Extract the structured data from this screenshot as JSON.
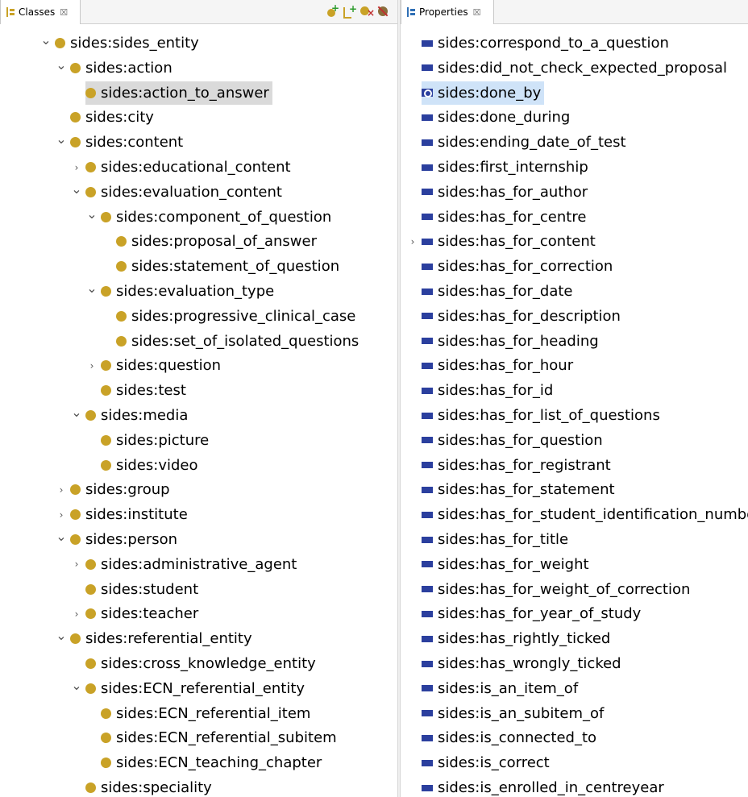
{
  "classes_panel": {
    "tab_label": "Classes",
    "tab_close": "☒",
    "toolbar": {
      "add_subclass": "add-subclass-icon",
      "add_sibling": "add-sibling-icon",
      "delete_class": "delete-class-icon",
      "deprecate": "deprecate-icon"
    },
    "items": [
      {
        "label": "sides:sides_entity",
        "depth": 0,
        "expander": "open"
      },
      {
        "label": "sides:action",
        "depth": 1,
        "expander": "open"
      },
      {
        "label": "sides:action_to_answer",
        "depth": 2,
        "expander": "none",
        "selected": true
      },
      {
        "label": "sides:city",
        "depth": 1,
        "expander": "none"
      },
      {
        "label": "sides:content",
        "depth": 1,
        "expander": "open"
      },
      {
        "label": "sides:educational_content",
        "depth": 2,
        "expander": "closed"
      },
      {
        "label": "sides:evaluation_content",
        "depth": 2,
        "expander": "open"
      },
      {
        "label": "sides:component_of_question",
        "depth": 3,
        "expander": "open"
      },
      {
        "label": "sides:proposal_of_answer",
        "depth": 4,
        "expander": "none"
      },
      {
        "label": "sides:statement_of_question",
        "depth": 4,
        "expander": "none"
      },
      {
        "label": "sides:evaluation_type",
        "depth": 3,
        "expander": "open"
      },
      {
        "label": "sides:progressive_clinical_case",
        "depth": 4,
        "expander": "none"
      },
      {
        "label": "sides:set_of_isolated_questions",
        "depth": 4,
        "expander": "none"
      },
      {
        "label": "sides:question",
        "depth": 3,
        "expander": "closed"
      },
      {
        "label": "sides:test",
        "depth": 3,
        "expander": "none"
      },
      {
        "label": "sides:media",
        "depth": 2,
        "expander": "open"
      },
      {
        "label": "sides:picture",
        "depth": 3,
        "expander": "none"
      },
      {
        "label": "sides:video",
        "depth": 3,
        "expander": "none"
      },
      {
        "label": "sides:group",
        "depth": 1,
        "expander": "closed"
      },
      {
        "label": "sides:institute",
        "depth": 1,
        "expander": "closed"
      },
      {
        "label": "sides:person",
        "depth": 1,
        "expander": "open"
      },
      {
        "label": "sides:administrative_agent",
        "depth": 2,
        "expander": "closed"
      },
      {
        "label": "sides:student",
        "depth": 2,
        "expander": "none"
      },
      {
        "label": "sides:teacher",
        "depth": 2,
        "expander": "closed"
      },
      {
        "label": "sides:referential_entity",
        "depth": 1,
        "expander": "open"
      },
      {
        "label": "sides:cross_knowledge_entity",
        "depth": 2,
        "expander": "none"
      },
      {
        "label": "sides:ECN_referential_entity",
        "depth": 2,
        "expander": "open"
      },
      {
        "label": "sides:ECN_referential_item",
        "depth": 3,
        "expander": "none"
      },
      {
        "label": "sides:ECN_referential_subitem",
        "depth": 3,
        "expander": "none"
      },
      {
        "label": "sides:ECN_teaching_chapter",
        "depth": 3,
        "expander": "none"
      },
      {
        "label": "sides:speciality",
        "depth": 2,
        "expander": "none"
      }
    ]
  },
  "properties_panel": {
    "tab_label": "Properties",
    "tab_close": "☒",
    "items": [
      {
        "label": "sides:correspond_to_a_question",
        "expander": "none"
      },
      {
        "label": "sides:did_not_check_expected_proposal",
        "expander": "none"
      },
      {
        "label": "sides:done_by",
        "expander": "none",
        "selected": true
      },
      {
        "label": "sides:done_during",
        "expander": "none"
      },
      {
        "label": "sides:ending_date_of_test",
        "expander": "none"
      },
      {
        "label": "sides:first_internship",
        "expander": "none"
      },
      {
        "label": "sides:has_for_author",
        "expander": "none"
      },
      {
        "label": "sides:has_for_centre",
        "expander": "none"
      },
      {
        "label": "sides:has_for_content",
        "expander": "closed"
      },
      {
        "label": "sides:has_for_correction",
        "expander": "none"
      },
      {
        "label": "sides:has_for_date",
        "expander": "none"
      },
      {
        "label": "sides:has_for_description",
        "expander": "none"
      },
      {
        "label": "sides:has_for_heading",
        "expander": "none"
      },
      {
        "label": "sides:has_for_hour",
        "expander": "none"
      },
      {
        "label": "sides:has_for_id",
        "expander": "none"
      },
      {
        "label": "sides:has_for_list_of_questions",
        "expander": "none"
      },
      {
        "label": "sides:has_for_question",
        "expander": "none"
      },
      {
        "label": "sides:has_for_registrant",
        "expander": "none"
      },
      {
        "label": "sides:has_for_statement",
        "expander": "none"
      },
      {
        "label": "sides:has_for_student_identification_number",
        "expander": "none"
      },
      {
        "label": "sides:has_for_title",
        "expander": "none"
      },
      {
        "label": "sides:has_for_weight",
        "expander": "none"
      },
      {
        "label": "sides:has_for_weight_of_correction",
        "expander": "none"
      },
      {
        "label": "sides:has_for_year_of_study",
        "expander": "none"
      },
      {
        "label": "sides:has_rightly_ticked",
        "expander": "none"
      },
      {
        "label": "sides:has_wrongly_ticked",
        "expander": "none"
      },
      {
        "label": "sides:is_an_item_of",
        "expander": "none"
      },
      {
        "label": "sides:is_an_subitem_of",
        "expander": "none"
      },
      {
        "label": "sides:is_connected_to",
        "expander": "none"
      },
      {
        "label": "sides:is_correct",
        "expander": "none"
      },
      {
        "label": "sides:is_enrolled_in_centreyear",
        "expander": "none"
      }
    ]
  },
  "colors": {
    "class_dot": "#c9a227",
    "property_bar": "#2b3f9e",
    "class_selection": "#dadada",
    "property_selection": "#cfe3f8"
  }
}
